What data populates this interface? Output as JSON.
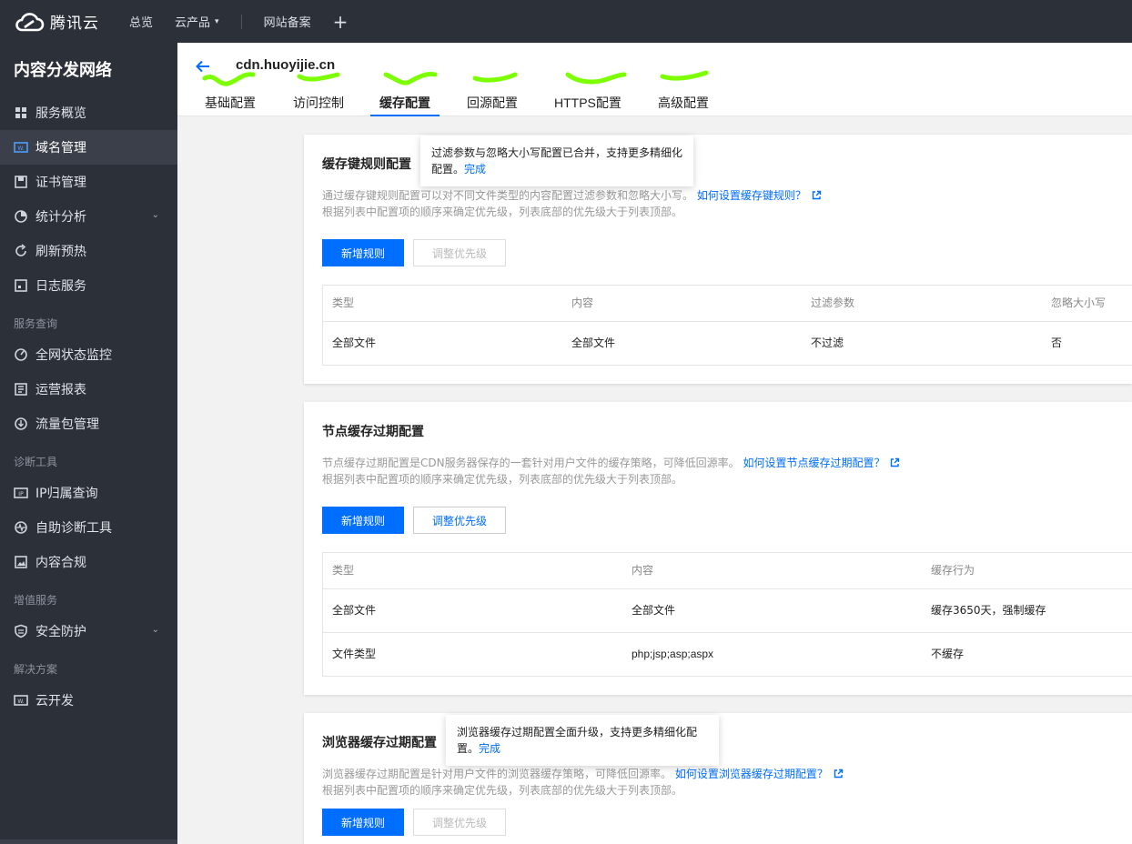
{
  "topbar": {
    "brand": "腾讯云",
    "nav": [
      {
        "label": "总览"
      },
      {
        "label": "云产品",
        "chevron": "▾"
      },
      {
        "label": "网站备案"
      }
    ],
    "plus": "+"
  },
  "sidebar": {
    "title": "内容分发网络",
    "items": [
      {
        "label": "服务概览",
        "icon": "grid-icon"
      },
      {
        "label": "域名管理",
        "icon": "domain-icon",
        "active": true
      },
      {
        "label": "证书管理",
        "icon": "certificate-icon"
      },
      {
        "label": "统计分析",
        "icon": "pie-chart-icon",
        "chevron": "⌄"
      },
      {
        "label": "刷新预热",
        "icon": "refresh-icon"
      },
      {
        "label": "日志服务",
        "icon": "log-icon"
      }
    ],
    "group_query": "服务查询",
    "query_items": [
      {
        "label": "全网状态监控",
        "icon": "gauge-icon"
      },
      {
        "label": "运营报表",
        "icon": "report-icon"
      },
      {
        "label": "流量包管理",
        "icon": "download-circle-icon"
      }
    ],
    "group_diag": "诊断工具",
    "diag_items": [
      {
        "label": "IP归属查询",
        "icon": "ip-icon"
      },
      {
        "label": "自助诊断工具",
        "icon": "pulse-icon"
      },
      {
        "label": "内容合规",
        "icon": "image-icon"
      }
    ],
    "group_value": "增值服务",
    "value_items": [
      {
        "label": "安全防护",
        "icon": "shield-icon",
        "chevron": "⌄"
      }
    ],
    "group_solution": "解决方案",
    "solution_items": [
      {
        "label": "云开发",
        "icon": "cloud-dev-icon"
      }
    ]
  },
  "page": {
    "domain": "cdn.huoyijie.cn",
    "tabs": [
      "基础配置",
      "访问控制",
      "缓存配置",
      "回源配置",
      "HTTPS配置",
      "高级配置"
    ],
    "active_tab": "缓存配置"
  },
  "cache_key": {
    "title": "缓存键规则配置",
    "desc_line1": "通过缓存键规则配置可以对不同文件类型的内容配置过滤参数和忽略大小写。",
    "link": "如何设置缓存键规则？",
    "desc_line2": "根据列表中配置项的顺序来确定优先级，列表底部的优先级大于列表顶部。",
    "add_btn": "新增规则",
    "priority_btn": "调整优先级",
    "columns": [
      "类型",
      "内容",
      "过滤参数",
      "忽略大小写"
    ],
    "rows": [
      [
        "全部文件",
        "全部文件",
        "不过滤",
        "否"
      ]
    ],
    "tip_text": "过滤参数与忽略大小写配置已合并，支持更多精细化配置。",
    "tip_done": "完成"
  },
  "node_cache": {
    "title": "节点缓存过期配置",
    "desc_line1": "节点缓存过期配置是CDN服务器保存的一套针对用户文件的缓存策略，可降低回源率。",
    "link": "如何设置节点缓存过期配置？",
    "desc_line2": "根据列表中配置项的顺序来确定优先级，列表底部的优先级大于列表顶部。",
    "add_btn": "新增规则",
    "priority_btn": "调整优先级",
    "columns": [
      "类型",
      "内容",
      "缓存行为"
    ],
    "rows": [
      [
        "全部文件",
        "全部文件",
        "缓存3650天，强制缓存"
      ],
      [
        "文件类型",
        "php;jsp;asp;aspx",
        "不缓存"
      ]
    ]
  },
  "browser_cache": {
    "title": "浏览器缓存过期配置",
    "desc_line1": "浏览器缓存过期配置是针对用户文件的浏览器缓存策略，可降低回源率。",
    "link": "如何设置浏览器缓存过期配置？",
    "desc_line2": "根据列表中配置项的顺序来确定优先级，列表底部的优先级大于列表顶部。",
    "add_btn": "新增规则",
    "priority_btn": "调整优先级",
    "tip_text": "浏览器缓存过期配置全面升级，支持更多精细化配置。",
    "tip_done": "完成"
  },
  "colors": {
    "accent": "#006eff",
    "sidebar_bg": "#2c3039",
    "highlight": "#7cff00"
  }
}
